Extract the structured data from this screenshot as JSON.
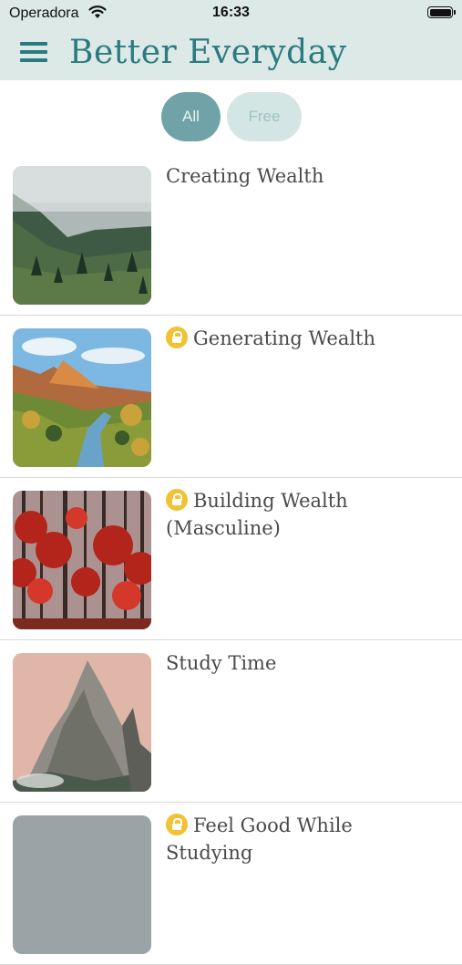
{
  "status_bar": {
    "carrier": "Operadora",
    "time": "16:33"
  },
  "header": {
    "title": "Better Everyday"
  },
  "filters": {
    "all_label": "All",
    "free_label": "Free",
    "selected": "All"
  },
  "items": [
    {
      "title": "Creating Wealth",
      "locked": false,
      "image": "misty-mountain-forest"
    },
    {
      "title": "Generating Wealth",
      "locked": true,
      "image": "canyon-river-autumn"
    },
    {
      "title": "Building Wealth (Masculine)",
      "locked": true,
      "image": "red-autumn-forest"
    },
    {
      "title": "Study Time",
      "locked": false,
      "image": "rocky-mountain-peak"
    },
    {
      "title": "Feel Good While Studying",
      "locked": true,
      "image": "mountain-landscape"
    }
  ],
  "colors": {
    "accent": "#2a7b80",
    "header_bg": "#dce9e6",
    "lock": "#f1c232"
  }
}
